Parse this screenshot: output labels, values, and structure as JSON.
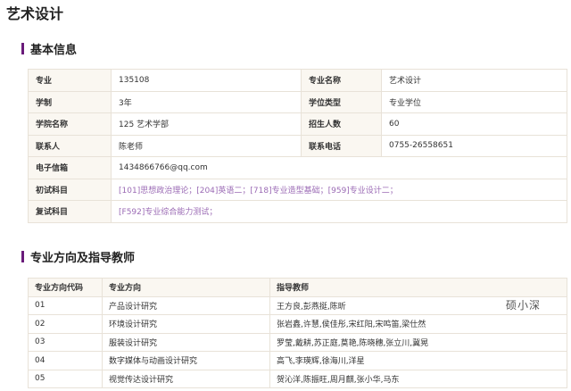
{
  "page": {
    "title": "艺术设计"
  },
  "basic_info": {
    "heading": "基本信息",
    "rows": [
      {
        "l1": "专业",
        "v1": "135108",
        "l2": "专业名称",
        "v2": "艺术设计"
      },
      {
        "l1": "学制",
        "v1": "3年",
        "l2": "学位类型",
        "v2": "专业学位"
      },
      {
        "l1": "学院名称",
        "v1": "125 艺术学部",
        "l2": "招生人数",
        "v2": "60"
      },
      {
        "l1": "联系人",
        "v1": "陈老师",
        "l2": "联系电话",
        "v2": "0755-26558651"
      }
    ],
    "email_label": "电子信箱",
    "email_value": "1434866766@qq.com",
    "first_exam_label": "初试科目",
    "first_exam_value": "[101]思想政治理论；[204]英语二；[718]专业造型基础；[959]专业设计二；",
    "second_exam_label": "复试科目",
    "second_exam_value": "[F592]专业综合能力测试；"
  },
  "directions": {
    "heading": "专业方向及指导教师",
    "columns": [
      "专业方向代码",
      "专业方向",
      "指导教师"
    ],
    "rows": [
      {
        "code": "01",
        "name": "产品设计研究",
        "teachers": "王方良,彭燕挺,陈昕"
      },
      {
        "code": "02",
        "name": "环境设计研究",
        "teachers": "张岩鑫,许慧,侯佳彤,宋红阳,宋鸣笛,梁仕然"
      },
      {
        "code": "03",
        "name": "服装设计研究",
        "teachers": "罗莹,戴耕,苏正庭,莫艳,陈晓穗,张立川,冀晃"
      },
      {
        "code": "04",
        "name": "数字媒体与动画设计研究",
        "teachers": "高飞,李瑛辉,徐海川,洋星"
      },
      {
        "code": "05",
        "name": "视觉传达设计研究",
        "teachers": "贺沁洋,陈振旺,周月麒,张小华,马东"
      }
    ]
  },
  "watermark": {
    "text": "硕小深"
  },
  "colors": {
    "accent": "#6a1b7a",
    "link": "#9b6bb5",
    "header_bg": "#faf7f1",
    "border": "#e8e2d8"
  }
}
